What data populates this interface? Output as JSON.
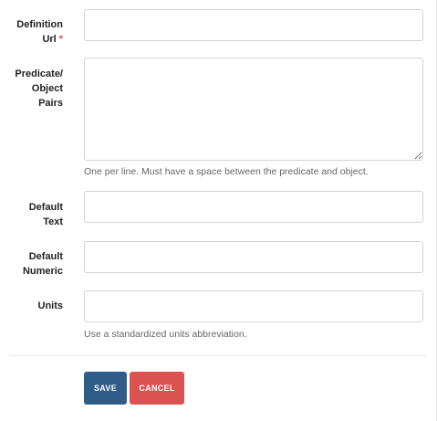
{
  "fields": {
    "definition_url": {
      "label_line1": "Definition",
      "label_line2": "Url",
      "required_mark": "*",
      "value": ""
    },
    "predicate_object": {
      "label_line1": "Predicate/",
      "label_line2": "Object",
      "label_line3": "Pairs",
      "value": "",
      "help": "One per line. Must have a space between the predicate and object."
    },
    "default_text": {
      "label_line1": "Default",
      "label_line2": "Text",
      "value": ""
    },
    "default_numeric": {
      "label_line1": "Default",
      "label_line2": "Numeric",
      "value": ""
    },
    "units": {
      "label": "Units",
      "value": "",
      "help": "Use a standardized units abbreviation."
    }
  },
  "actions": {
    "save_label": "SAVE",
    "cancel_label": "CANCEL"
  },
  "colors": {
    "save": "#2f5d88",
    "cancel": "#db5350",
    "required": "#d9534f"
  }
}
